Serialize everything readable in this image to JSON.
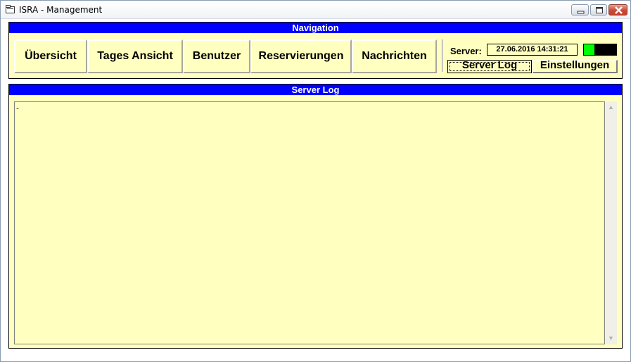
{
  "window": {
    "title": "ISRA - Management",
    "icon": "window-app-icon",
    "controls": {
      "minimize": "minimize-icon",
      "maximize": "maximize-icon",
      "close": "close-icon"
    }
  },
  "navigation": {
    "header": "Navigation",
    "buttons": [
      {
        "label": "Übersicht"
      },
      {
        "label": "Tages Ansicht"
      },
      {
        "label": "Benutzer"
      },
      {
        "label": "Reservierungen"
      },
      {
        "label": "Nachrichten"
      }
    ],
    "server": {
      "label": "Server:",
      "timestamp": "27.06.2016 14:31:21",
      "status_leds": [
        "#00ff00",
        "#000000",
        "#000000"
      ]
    },
    "server_log_button": "Server Log",
    "settings_button": "Einstellungen"
  },
  "log": {
    "header": "Server Log",
    "content": "-"
  },
  "colors": {
    "panel_background": "#ffffc0",
    "header_background": "#0000ff",
    "header_text": "#ffffff"
  }
}
